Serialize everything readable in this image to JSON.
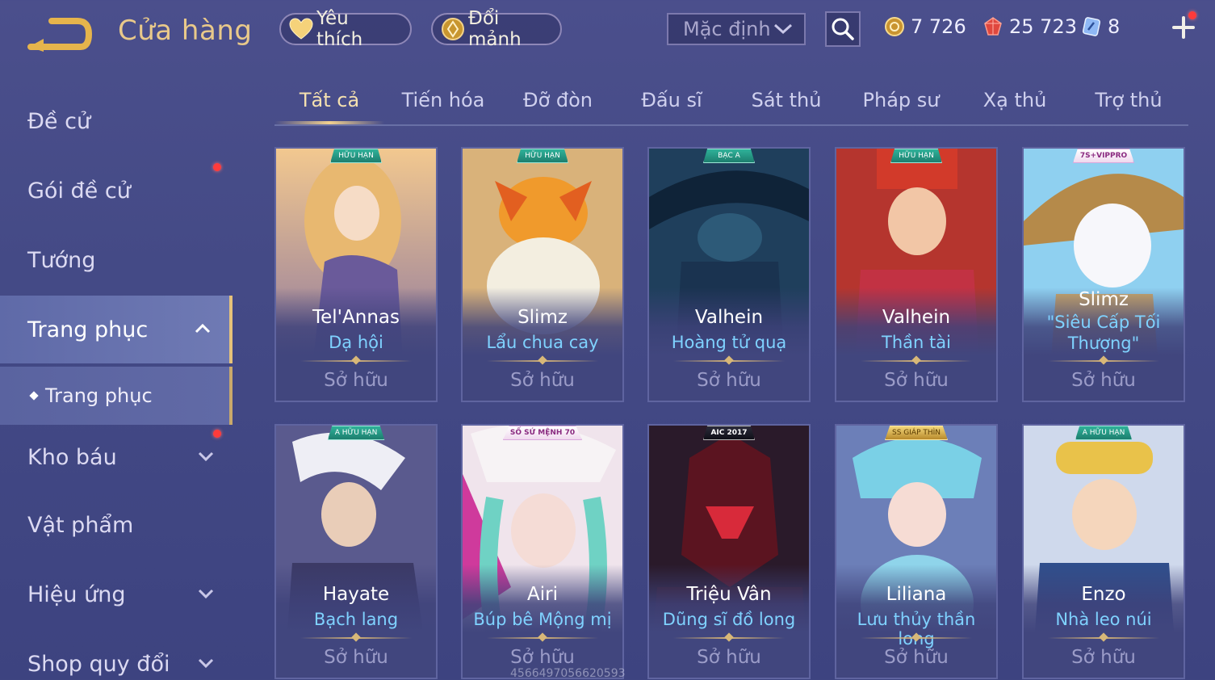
{
  "header": {
    "title": "Cửa hàng",
    "favorite_label": "Yêu thích",
    "shard_exchange_label": "Đổi mảnh",
    "sort_value": "Mặc định"
  },
  "currencies": {
    "gold": "7 726",
    "gems": "25 723",
    "tickets": "8"
  },
  "sidebar": {
    "items": [
      {
        "label": "Đề cử"
      },
      {
        "label": "Gói đề cử"
      },
      {
        "label": "Tướng"
      },
      {
        "label": "Trang phục"
      },
      {
        "label": "Kho báu"
      },
      {
        "label": "Vật phẩm"
      },
      {
        "label": "Hiệu ứng"
      },
      {
        "label": "Shop quy đổi"
      }
    ],
    "sub_item": "Trang phục"
  },
  "tabs": [
    "Tất cả",
    "Tiến hóa",
    "Đỡ đòn",
    "Đấu sĩ",
    "Sát thủ",
    "Pháp sư",
    "Xạ thủ",
    "Trợ thủ"
  ],
  "cards": [
    {
      "hero": "Tel'Annas",
      "skin": "Dạ hội",
      "status": "Sở hữu",
      "badge": "HỮU HẠN"
    },
    {
      "hero": "Slimz",
      "skin": "Lẩu chua cay",
      "status": "Sở hữu",
      "badge": "HỮU HẠN"
    },
    {
      "hero": "Valhein",
      "skin": "Hoàng tử quạ",
      "status": "Sở hữu",
      "badge": "BẠC A"
    },
    {
      "hero": "Valhein",
      "skin": "Thần tài",
      "status": "Sở hữu",
      "badge": "HỮU HẠN"
    },
    {
      "hero": "Slimz",
      "skin": "\"Siêu Cấp Tối Thượng\"",
      "status": "Sở hữu",
      "badge": "7S+VIPPRO"
    },
    {
      "hero": "Hayate",
      "skin": "Bạch lang",
      "status": "Sở hữu",
      "badge": "A HỮU HẠN"
    },
    {
      "hero": "Airi",
      "skin": "Búp bê Mộng mị",
      "status": "Sở hữu",
      "badge": "SỐ SỨ MỆNH 70"
    },
    {
      "hero": "Triệu Vân",
      "skin": "Dũng sĩ đồ long",
      "status": "Sở hữu",
      "badge": "AIC 2017"
    },
    {
      "hero": "Liliana",
      "skin": "Lưu thủy thần long",
      "status": "Sở hữu",
      "badge": "SS GIÁP THÌN"
    },
    {
      "hero": "Enzo",
      "skin": "Nhà leo núi",
      "status": "Sở hữu",
      "badge": "A HỮU HẠN"
    }
  ],
  "watermark": "4566497056620593",
  "colors": {
    "accent_gold": "#e9c98a",
    "skin_text": "#7fd2ff",
    "notification": "#ff3b3b"
  }
}
